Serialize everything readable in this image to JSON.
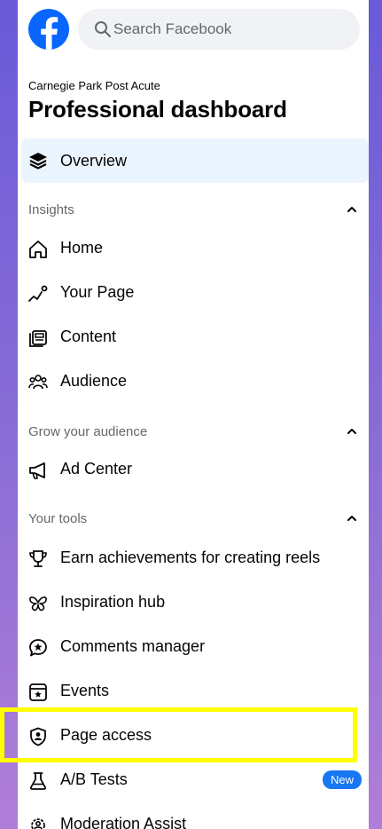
{
  "search": {
    "placeholder": "Search Facebook"
  },
  "header": {
    "page_name": "Carnegie Park Post Acute",
    "title": "Professional dashboard"
  },
  "nav": {
    "overview": {
      "label": "Overview",
      "icon": "layers-icon"
    },
    "sections": [
      {
        "label": "Insights",
        "items": [
          {
            "label": "Home",
            "icon": "home-icon"
          },
          {
            "label": "Your Page",
            "icon": "trend-line-icon"
          },
          {
            "label": "Content",
            "icon": "content-icon"
          },
          {
            "label": "Audience",
            "icon": "people-icon"
          }
        ]
      },
      {
        "label": "Grow your audience",
        "items": [
          {
            "label": "Ad Center",
            "icon": "megaphone-icon"
          }
        ]
      },
      {
        "label": "Your tools",
        "items": [
          {
            "label": "Earn achievements for creating reels",
            "icon": "trophy-icon"
          },
          {
            "label": "Inspiration hub",
            "icon": "butterfly-icon"
          },
          {
            "label": "Comments manager",
            "icon": "comment-star-icon"
          },
          {
            "label": "Events",
            "icon": "calendar-star-icon"
          },
          {
            "label": "Page access",
            "icon": "shield-person-icon"
          },
          {
            "label": "A/B Tests",
            "icon": "flask-icon",
            "badge": "New"
          },
          {
            "label": "Moderation Assist",
            "icon": "gear-people-icon"
          }
        ]
      }
    ]
  },
  "colors": {
    "brand": "#0866ff",
    "highlight": "#ffff00",
    "active_bg": "#ebf5ff",
    "badge": "#1877f2"
  }
}
